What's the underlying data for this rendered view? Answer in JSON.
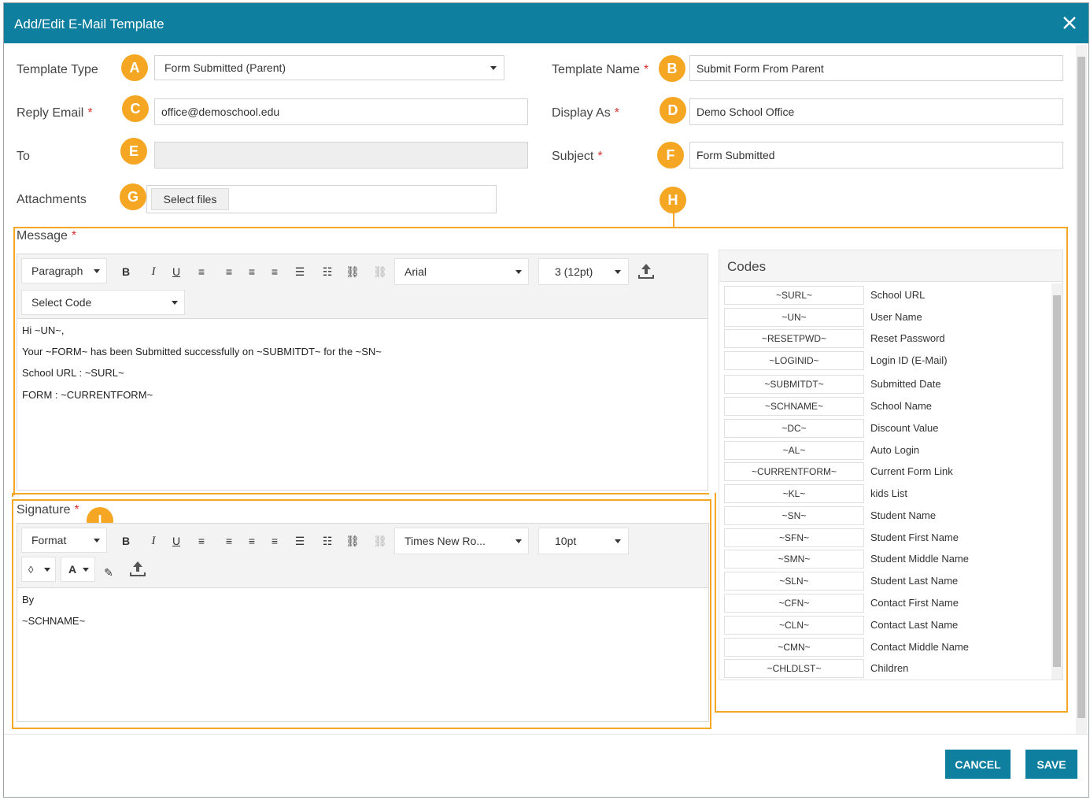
{
  "dialog": {
    "title": "Add/Edit E-Mail Template"
  },
  "fields": {
    "template_type": {
      "label": "Template Type",
      "value": "Form Submitted (Parent)",
      "badge": "A"
    },
    "template_name": {
      "label": "Template Name",
      "required": "*",
      "value": "Submit Form From Parent",
      "badge": "B"
    },
    "reply_email": {
      "label": "Reply Email",
      "required": "*",
      "value": "office@demoschool.edu",
      "badge": "C"
    },
    "display_as": {
      "label": "Display As",
      "required": "*",
      "value": "Demo School Office",
      "badge": "D"
    },
    "to": {
      "label": "To",
      "value": "",
      "badge": "E"
    },
    "subject": {
      "label": "Subject",
      "required": "*",
      "value": "Form Submitted",
      "badge": "F"
    },
    "attachments": {
      "label": "Attachments",
      "button": "Select files",
      "badge": "G"
    }
  },
  "message": {
    "label": "Message",
    "required": "*",
    "badge": "H",
    "toolbar": {
      "block_format": "Paragraph",
      "font": "Arial",
      "size": "3 (12pt)",
      "select_code": "Select Code"
    },
    "lines": [
      "Hi ~UN~,",
      "Your ~FORM~ has been Submitted successfully on ~SUBMITDT~ for the ~SN~",
      "School URL : ~SURL~",
      "FORM : ~CURRENTFORM~"
    ]
  },
  "signature": {
    "label": "Signature",
    "required": "*",
    "badge": "I",
    "toolbar": {
      "block_format": "Format",
      "font": "Times New Ro...",
      "size": "10pt",
      "text_color": "A"
    },
    "lines": [
      "By",
      "~SCHNAME~"
    ]
  },
  "codes": {
    "title": "Codes",
    "items": [
      {
        "code": "~SURL~",
        "desc": "School URL"
      },
      {
        "code": "~UN~",
        "desc": "User Name"
      },
      {
        "code": "~RESETPWD~",
        "desc": "Reset Password"
      },
      {
        "code": "~LOGINID~",
        "desc": "Login ID (E-Mail)"
      },
      {
        "code": "~SUBMITDT~",
        "desc": "Submitted Date"
      },
      {
        "code": "~SCHNAME~",
        "desc": "School Name"
      },
      {
        "code": "~DC~",
        "desc": "Discount Value"
      },
      {
        "code": "~AL~",
        "desc": "Auto Login"
      },
      {
        "code": "~CURRENTFORM~",
        "desc": "Current Form Link"
      },
      {
        "code": "~KL~",
        "desc": "kids List"
      },
      {
        "code": "~SN~",
        "desc": "Student Name"
      },
      {
        "code": "~SFN~",
        "desc": "Student First Name"
      },
      {
        "code": "~SMN~",
        "desc": "Student Middle Name"
      },
      {
        "code": "~SLN~",
        "desc": "Student Last Name"
      },
      {
        "code": "~CFN~",
        "desc": "Contact First Name"
      },
      {
        "code": "~CLN~",
        "desc": "Contact Last Name"
      },
      {
        "code": "~CMN~",
        "desc": "Contact Middle Name"
      },
      {
        "code": "~CHLDLST~",
        "desc": "Children"
      }
    ]
  },
  "footer": {
    "cancel": "CANCEL",
    "save": "SAVE"
  },
  "colors": {
    "header": "#0f7fa0",
    "badge": "#f5a623",
    "required": "#d43131"
  }
}
